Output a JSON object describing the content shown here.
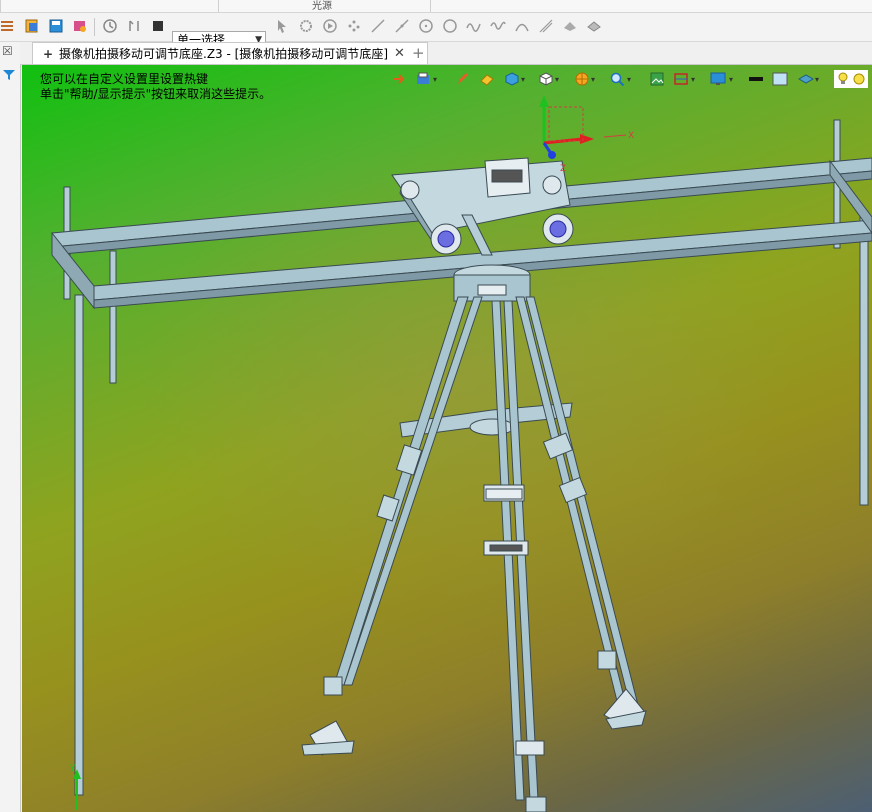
{
  "ribbon": {
    "group_label": "光源"
  },
  "toolbar": {
    "selection_mode": "单一选择"
  },
  "document": {
    "tab_title": "摄像机拍摄移动可调节底座.Z3 - [摄像机拍摄移动可调节底座]",
    "close_symbol": "✕",
    "new_tab_symbol": "+",
    "pin_symbol": "+"
  },
  "viewport": {
    "hint_line1": "您可以在自定义设置里设置热键",
    "hint_line2": "单击\"帮助/显示提示\"按钮来取消这些提示。"
  },
  "colors": {
    "accent_bg_top": "#10c010",
    "frame_metal": "#a8c4cf",
    "x_axis": "#e02020",
    "y_axis": "#20c020",
    "z_axis": "#2040e0"
  }
}
